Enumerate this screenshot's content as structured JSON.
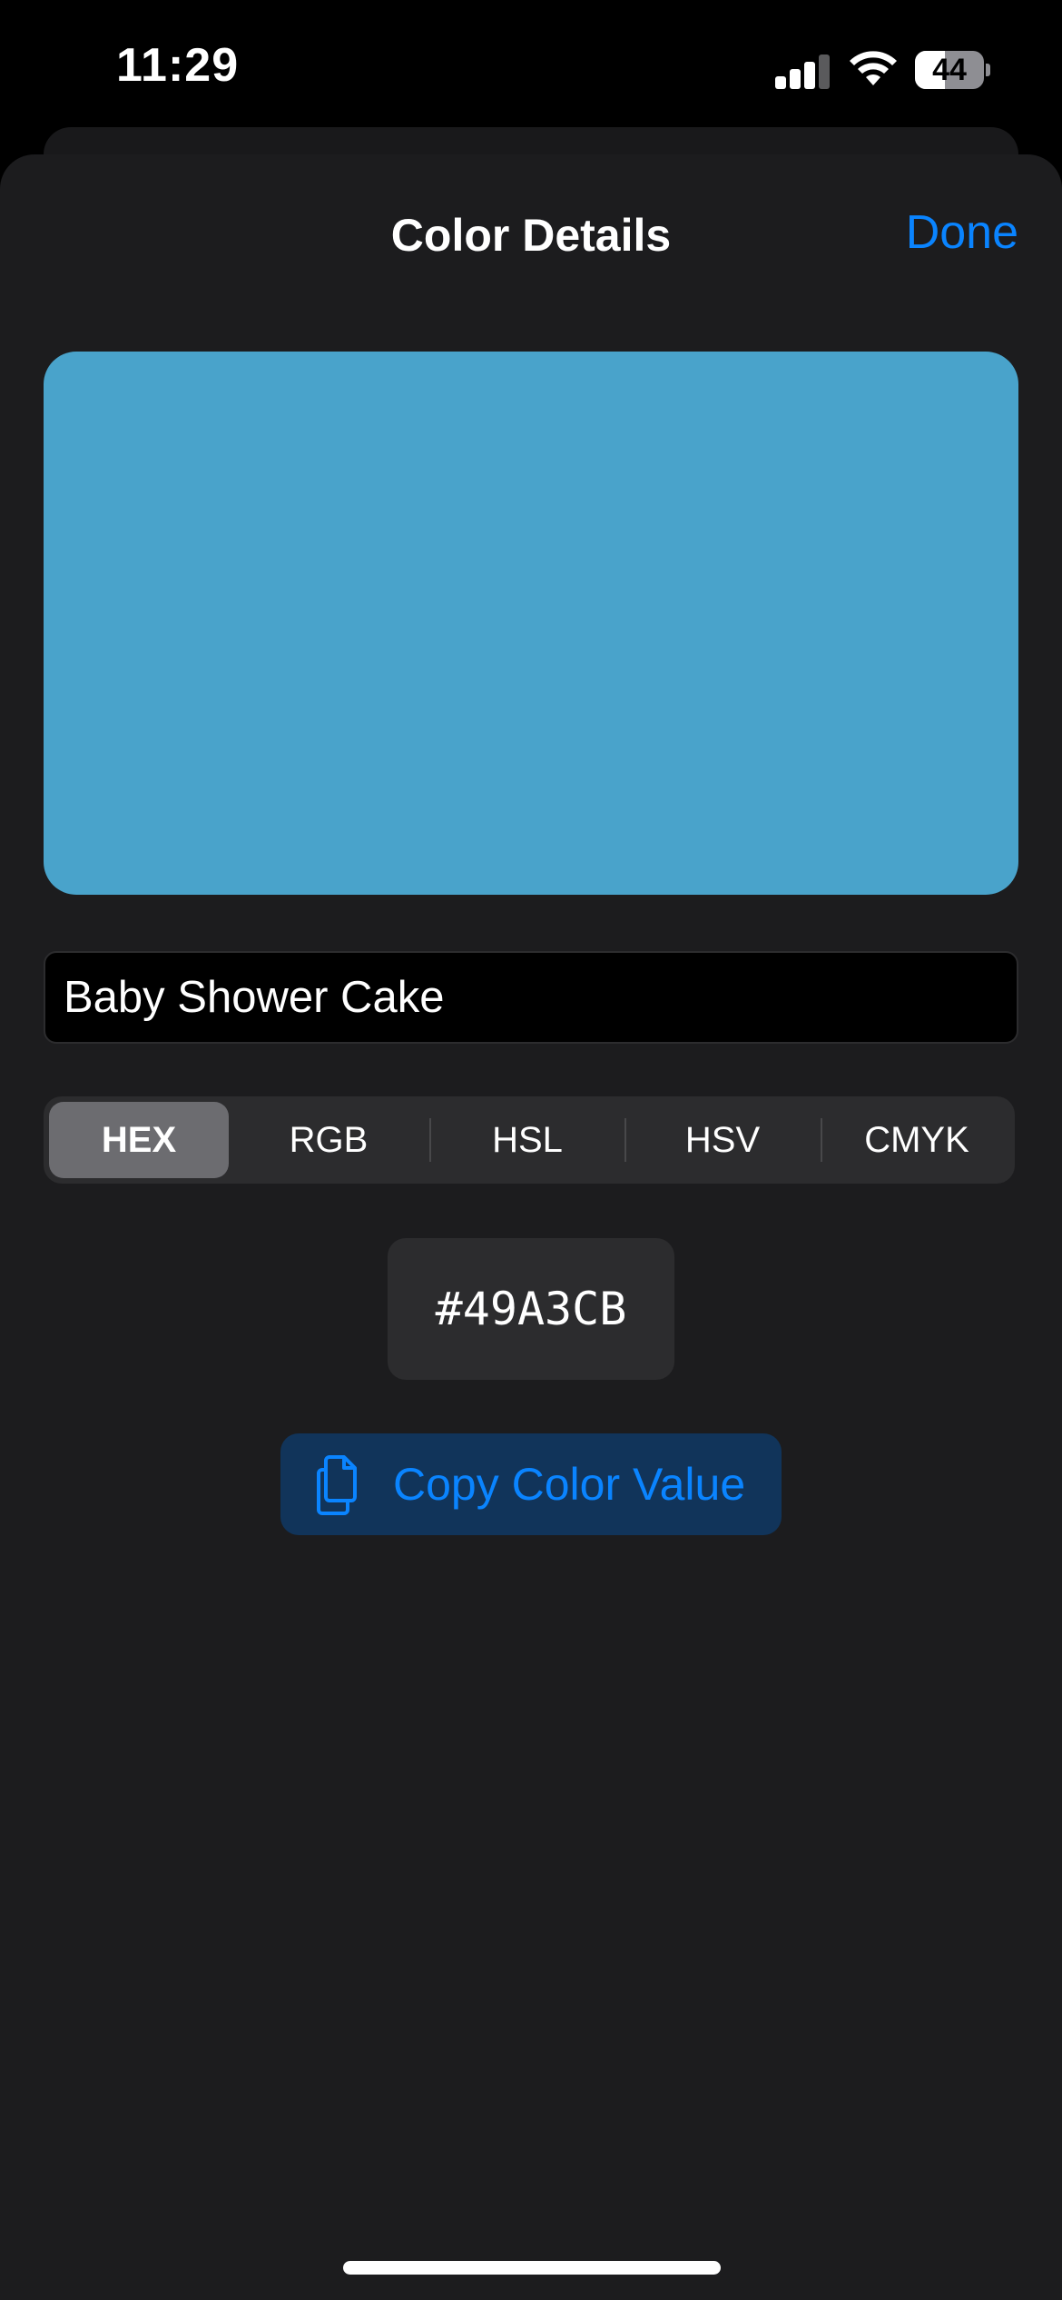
{
  "status_bar": {
    "time": "11:29",
    "battery_level": "44",
    "battery_fraction": 0.44
  },
  "nav": {
    "title": "Color Details",
    "done_label": "Done"
  },
  "color": {
    "swatch_hex": "#49A3CB",
    "name": "Baby Shower Cake"
  },
  "format_tabs": {
    "selected": "HEX",
    "items": [
      "HEX",
      "RGB",
      "HSL",
      "HSV",
      "CMYK"
    ]
  },
  "value_display": "#49A3CB",
  "copy_button": {
    "label": "Copy Color Value",
    "icon": "doc-on-doc-icon"
  },
  "theme": {
    "accent": "#0A84FF",
    "background": "#1C1C1E"
  }
}
